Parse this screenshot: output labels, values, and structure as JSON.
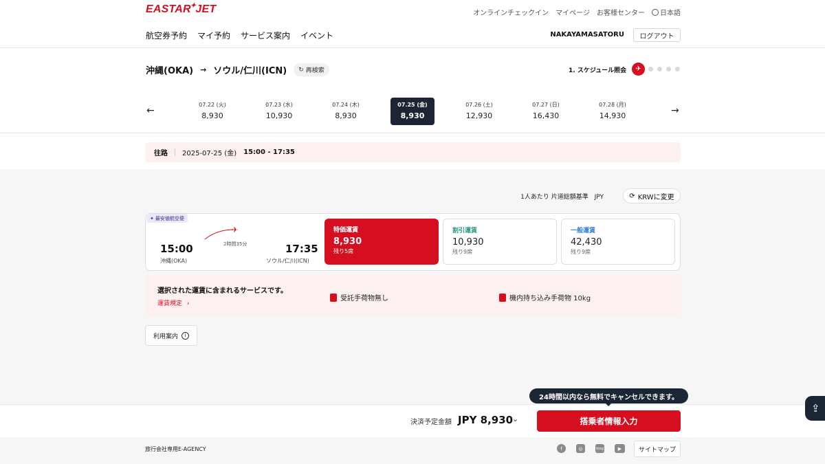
{
  "header": {
    "logo": "EASTAR JET",
    "utility_links": [
      "オンラインチェックイン",
      "マイページ",
      "お客様センター",
      "日本語"
    ],
    "nav": [
      "航空券予約",
      "マイ予約",
      "サービス案内",
      "イベント"
    ],
    "user_name": "NAKAYAMASATORU",
    "logout_label": "ログアウト"
  },
  "route": {
    "origin": "沖縄(OKA)",
    "destination": "ソウル/仁川(ICN)",
    "research_label": "再検索",
    "step_label": "1. スケジュール照会"
  },
  "dates": [
    {
      "date": "07.22 (火)",
      "price": "8,930",
      "selected": false
    },
    {
      "date": "07.23 (水)",
      "price": "10,930",
      "selected": false
    },
    {
      "date": "07.24 (木)",
      "price": "8,930",
      "selected": false
    },
    {
      "date": "07.25 (金)",
      "price": "8,930",
      "selected": true
    },
    {
      "date": "07.26 (土)",
      "price": "12,930",
      "selected": false
    },
    {
      "date": "07.27 (日)",
      "price": "16,430",
      "selected": false
    },
    {
      "date": "07.28 (月)",
      "price": "14,930",
      "selected": false
    }
  ],
  "outbound": {
    "label": "往路",
    "date": "2025-07-25 (金)",
    "time": "15:00 - 17:35"
  },
  "currency": {
    "basis": "1人あたり 片道総額基準",
    "code": "JPY",
    "change_label": "KRWに変更"
  },
  "flight": {
    "badge": "最安値航空便",
    "dep_time": "15:00",
    "dep_airport": "沖縄(OKA)",
    "duration": "2時間35分",
    "arr_time": "17:35",
    "arr_airport": "ソウル/仁川(ICN)"
  },
  "fares": {
    "special": {
      "name": "特価運賃",
      "price": "8,930",
      "seats": "残り5席"
    },
    "discount": {
      "name": "割引運賃",
      "price": "10,930",
      "seats": "残り9席"
    },
    "normal": {
      "name": "一般運賃",
      "price": "42,430",
      "seats": "残り9席"
    }
  },
  "services": {
    "title": "選択された運賃に含まれるサービスです。",
    "rules_link": "運賃規定",
    "checked_baggage": "受託手荷物無し",
    "carry_on": "機内持ち込み手荷物 10kg"
  },
  "guide_label": "利用案内",
  "payment": {
    "label": "決済予定金額",
    "amount": "JPY 8,930",
    "cta": "搭乗者情報入力",
    "tooltip": "24時間以内なら無料でキャンセルできます。"
  },
  "footer": {
    "agency": "旅行会社専用E-AGENCY",
    "blog": "blog",
    "sitemap": "サイトマップ"
  },
  "colors": {
    "brand_red": "#d50f1f",
    "navy": "#1b2533",
    "pink_bg": "#fdf0f0"
  }
}
